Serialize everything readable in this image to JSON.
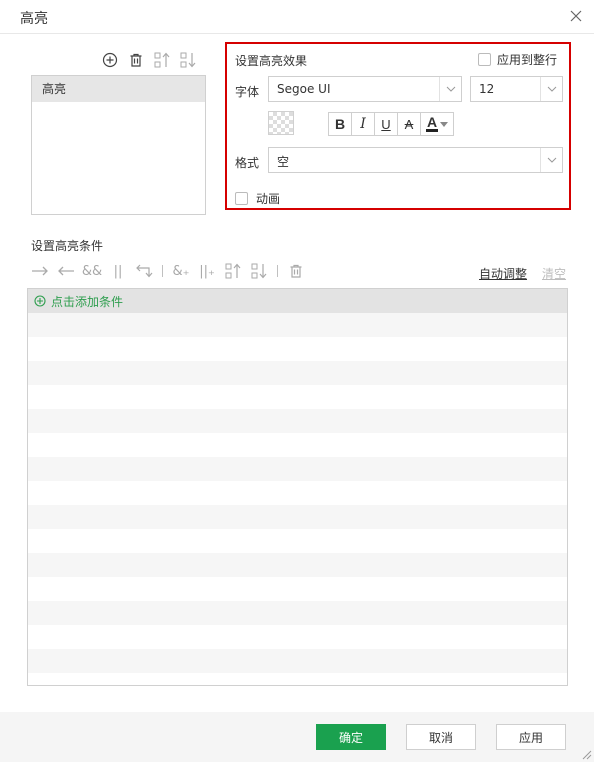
{
  "dialog": {
    "title": "高亮",
    "close_icon": "close-icon"
  },
  "rule_toolbar": {
    "icons": [
      "add-circle-icon",
      "trash-icon",
      "move-up-icon",
      "move-down-icon"
    ]
  },
  "rule_list": {
    "items": [
      {
        "label": "高亮"
      }
    ]
  },
  "effect": {
    "title": "设置高亮效果",
    "apply_to_row_label": "应用到整行",
    "apply_to_row_checked": false,
    "font_label": "字体",
    "font_value": "Segoe UI",
    "font_size": "12",
    "style_buttons": {
      "bold": "B",
      "italic": "I",
      "underline": "U",
      "strike": "A",
      "font_color": "A"
    },
    "format_label": "格式",
    "format_value": "空",
    "animation_label": "动画",
    "animation_checked": false
  },
  "conditions": {
    "title": "设置高亮条件",
    "toolbar": {
      "icons": [
        "indent-icon",
        "outdent-icon",
        "and-icon",
        "or-icon",
        "swap-icon",
        "add-and-icon",
        "add-or-icon",
        "move-up-icon",
        "move-down-icon",
        "trash-icon"
      ],
      "glyphs": {
        "and": "&&",
        "or": "||",
        "add_and": "&₊",
        "add_or": "||₊"
      }
    },
    "auto_adjust_label": "自动调整",
    "clear_label": "清空",
    "add_condition_label": "点击添加条件"
  },
  "footer": {
    "ok_label": "确定",
    "cancel_label": "取消",
    "apply_label": "应用"
  },
  "colors": {
    "accent_green": "#1aa14f",
    "highlight_border": "#d50000"
  }
}
